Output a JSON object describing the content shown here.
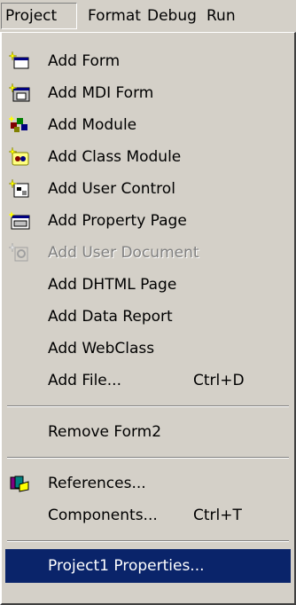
{
  "menubar": {
    "items": [
      "Project",
      "Format",
      "Debug",
      "Run"
    ]
  },
  "menu": {
    "add_form": "Add Form",
    "add_mdi_form": "Add MDI Form",
    "add_module": "Add Module",
    "add_class_module": "Add Class Module",
    "add_user_control": "Add User Control",
    "add_property_page": "Add Property Page",
    "add_user_document": "Add User Document",
    "add_dhtml_page": "Add DHTML Page",
    "add_data_report": "Add Data Report",
    "add_webclass": "Add WebClass",
    "add_file": "Add File...",
    "add_file_shortcut": "Ctrl+D",
    "remove_form": "Remove Form2",
    "references": "References...",
    "components": "Components...",
    "components_shortcut": "Ctrl+T",
    "project_properties": "Project1 Properties..."
  },
  "colors": {
    "face": "#d4d0c8",
    "highlight": "#0a246a",
    "disabled_text": "#808080"
  }
}
